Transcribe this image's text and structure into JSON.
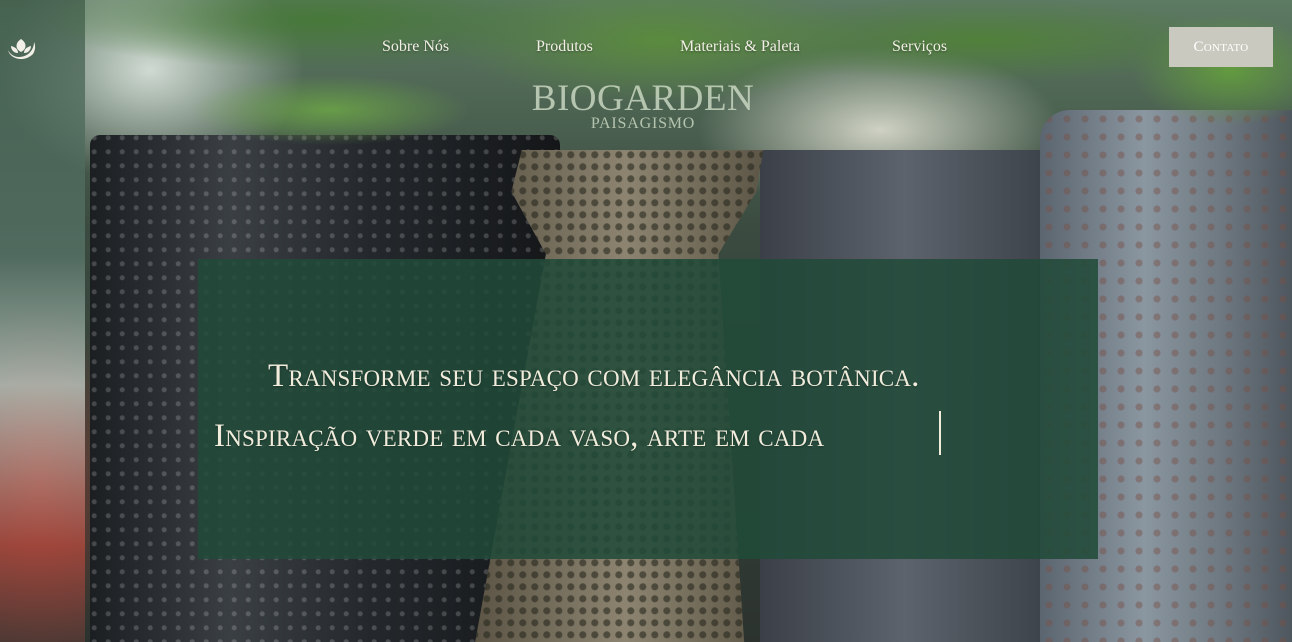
{
  "header": {
    "logo_icon": "leaf-moon-icon",
    "nav": [
      {
        "label": "Sobre Nós"
      },
      {
        "label": "Produtos"
      },
      {
        "label": "Materiais & Paleta"
      },
      {
        "label": "Serviços"
      }
    ],
    "contact_label": "Contato"
  },
  "brand": {
    "name": "BIOGARDEN",
    "subtitle": "PAISAGISMO"
  },
  "hero": {
    "line1": "Transforme seu espaço com elegância botânica.",
    "line2": "Inspiração verde em cada vaso, arte em cada"
  },
  "colors": {
    "panel": "#214b39",
    "text": "#f1ecdc",
    "button": "#c9c9bf"
  }
}
